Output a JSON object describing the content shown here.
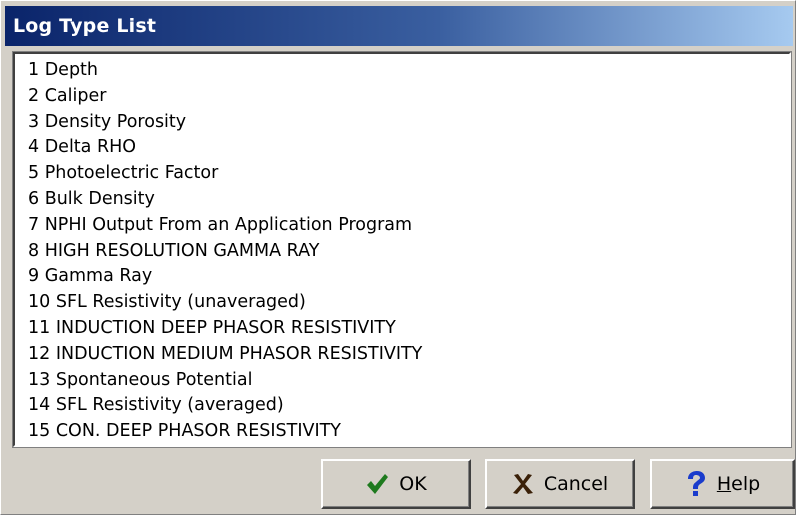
{
  "window": {
    "title": "Log Type List"
  },
  "list": {
    "items": [
      "1 Depth",
      "2 Caliper",
      "3 Density Porosity",
      "4 Delta  RHO",
      "5 Photoelectric Factor",
      "6 Bulk Density",
      "7 NPHI Output From an Application Program",
      "8 HIGH RESOLUTION GAMMA RAY",
      "9 Gamma Ray",
      "10 SFL Resistivity (unaveraged)",
      "11 INDUCTION DEEP PHASOR RESISTIVITY",
      "12 INDUCTION MEDIUM PHASOR RESISTIVITY",
      "13 Spontaneous Potential",
      "14 SFL Resistivity (averaged)",
      "15 CON. DEEP PHASOR RESISTIVITY"
    ]
  },
  "buttons": {
    "ok": {
      "label": "OK",
      "icon": "checkmark-icon",
      "icon_color": "#1e7a1e"
    },
    "cancel": {
      "label": "Cancel",
      "icon": "x-icon",
      "icon_color": "#3a2008"
    },
    "help": {
      "label_underlined": "H",
      "label_rest": "elp",
      "icon": "question-mark-icon",
      "icon_color": "#1a3ccc"
    }
  },
  "colors": {
    "titlebar_start": "#0a246a",
    "titlebar_end": "#a6caf0",
    "dialog_face": "#d4d0c8"
  }
}
